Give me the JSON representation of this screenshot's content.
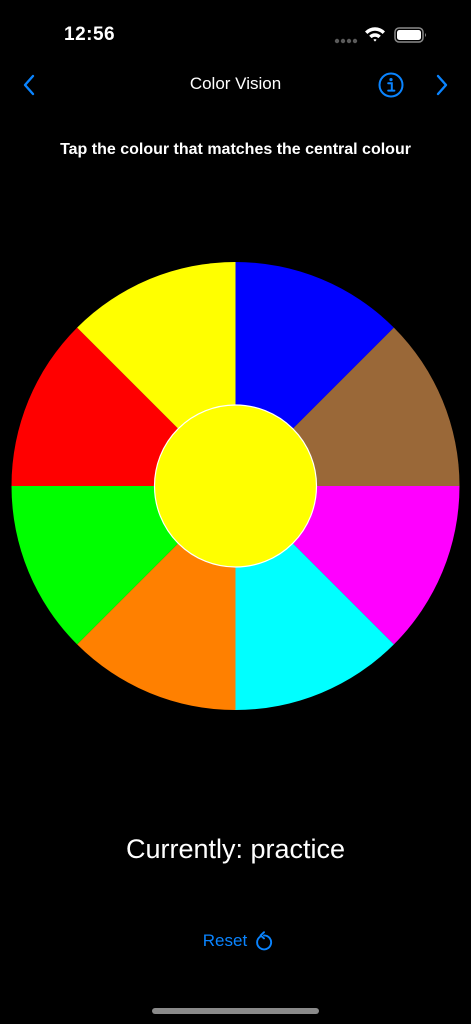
{
  "status_bar": {
    "time": "12:56"
  },
  "nav": {
    "title": "Color Vision",
    "back_icon": "chevron-left-icon",
    "info_icon": "info-icon",
    "forward_icon": "chevron-right-icon"
  },
  "instruction": "Tap the colour that matches the central colour",
  "wheel": {
    "center_color": "#ffff00",
    "segments": [
      {
        "name": "blue",
        "color": "#0000ff"
      },
      {
        "name": "brown",
        "color": "#9a6838"
      },
      {
        "name": "magenta",
        "color": "#ff00ff"
      },
      {
        "name": "cyan",
        "color": "#00ffff"
      },
      {
        "name": "orange",
        "color": "#ff8000"
      },
      {
        "name": "green",
        "color": "#00ff00"
      },
      {
        "name": "red",
        "color": "#ff0000"
      },
      {
        "name": "yellow",
        "color": "#ffff00"
      }
    ]
  },
  "status_text": "Currently: practice",
  "reset": {
    "label": "Reset",
    "icon": "reset-icon"
  },
  "colors": {
    "accent": "#0a84ff",
    "background": "#000000",
    "text": "#ffffff"
  }
}
